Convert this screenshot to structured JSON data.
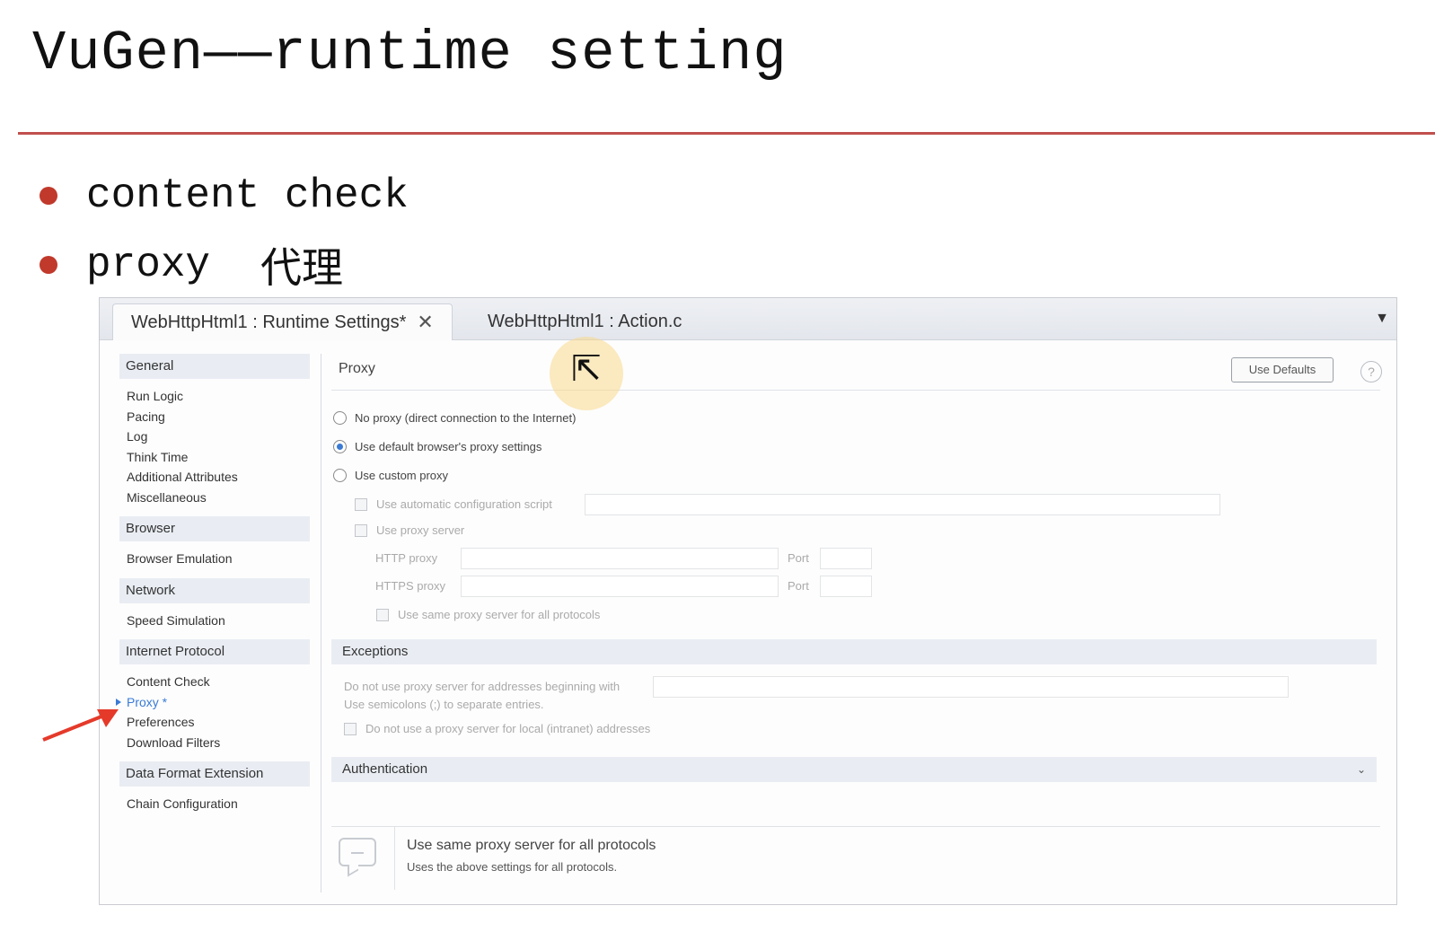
{
  "slide": {
    "title": "VuGen——runtime setting",
    "bullets": [
      {
        "text": "content check",
        "cn": ""
      },
      {
        "text": "proxy",
        "cn": "代理"
      }
    ]
  },
  "tabs": [
    {
      "label": "WebHttpHtml1 : Runtime Settings*",
      "active": true
    },
    {
      "label": "WebHttpHtml1 : Action.c",
      "active": false
    }
  ],
  "sidebar": {
    "groups": [
      {
        "label": "General",
        "items": [
          "Run Logic",
          "Pacing",
          "Log",
          "Think Time",
          "Additional Attributes",
          "Miscellaneous"
        ]
      },
      {
        "label": "Browser",
        "items": [
          "Browser Emulation"
        ]
      },
      {
        "label": "Network",
        "items": [
          "Speed Simulation"
        ]
      },
      {
        "label": "Internet Protocol",
        "items": [
          "Content Check",
          "Proxy *",
          "Preferences",
          "Download Filters"
        ]
      },
      {
        "label": "Data Format Extension",
        "items": [
          "Chain Configuration"
        ]
      }
    ]
  },
  "panel": {
    "title": "Proxy",
    "use_defaults": "Use Defaults",
    "help": "?",
    "options": {
      "no_proxy": "No proxy (direct connection to the Internet)",
      "default_browser": "Use default browser's proxy settings",
      "custom": "Use custom proxy"
    },
    "custom": {
      "auto_script": "Use automatic configuration script",
      "use_proxy_server": "Use proxy server",
      "http_proxy": "HTTP proxy",
      "https_proxy": "HTTPS proxy",
      "port": "Port",
      "same_proxy": "Use same proxy server for all protocols"
    },
    "exceptions": {
      "header": "Exceptions",
      "line1": "Do not use proxy server for addresses beginning with",
      "line2": "Use semicolons (;) to separate entries.",
      "local": "Do not use a proxy server for local (intranet) addresses"
    },
    "authentication": {
      "header": "Authentication"
    },
    "tip": {
      "title": "Use same proxy server for all protocols",
      "text": "Uses the above settings for all protocols."
    }
  },
  "colors": {
    "accent": "#c0504d",
    "selection": "#3a7bd5",
    "arrow": "#e53a2a"
  }
}
